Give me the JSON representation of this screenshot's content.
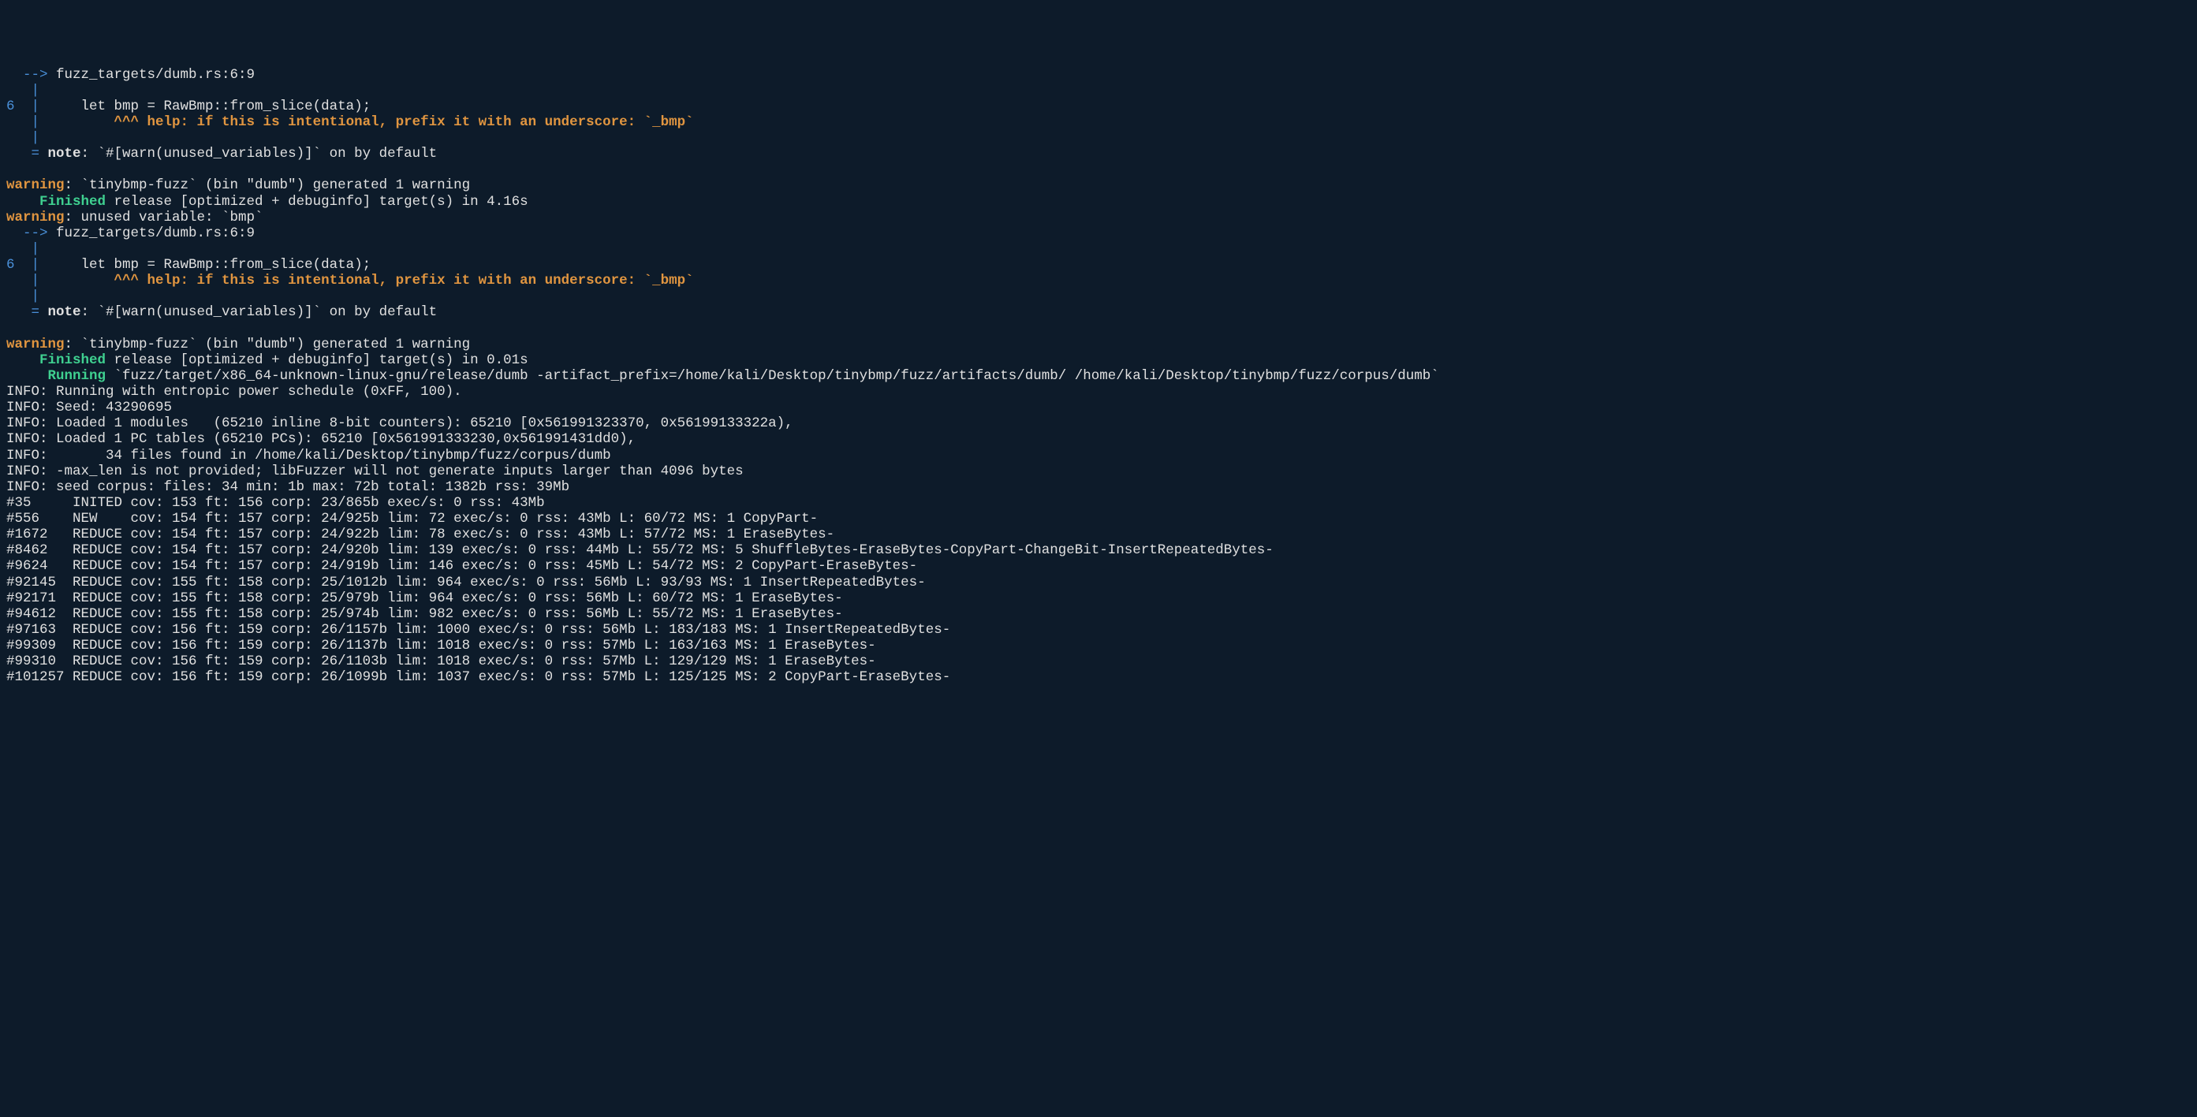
{
  "lines": [
    {
      "segs": [
        {
          "cls": "arrow",
          "t": "  -->"
        },
        {
          "cls": "normal",
          "t": " fuzz_targets/dumb.rs:6:9"
        }
      ]
    },
    {
      "segs": [
        {
          "cls": "pipe",
          "t": "   |"
        }
      ]
    },
    {
      "segs": [
        {
          "cls": "linenum",
          "t": "6  |"
        },
        {
          "cls": "normal",
          "t": "     let bmp = RawBmp::from_slice(data);"
        }
      ]
    },
    {
      "segs": [
        {
          "cls": "pipe",
          "t": "   |"
        },
        {
          "cls": "normal",
          "t": "         "
        },
        {
          "cls": "help",
          "t": "^^^ help: if this is intentional, prefix it with an underscore: `_bmp`"
        }
      ]
    },
    {
      "segs": [
        {
          "cls": "pipe",
          "t": "   |"
        }
      ]
    },
    {
      "segs": [
        {
          "cls": "note-eq",
          "t": "   = "
        },
        {
          "cls": "note-label",
          "t": "note"
        },
        {
          "cls": "normal",
          "t": ": `#[warn(unused_variables)]` on by default"
        }
      ]
    },
    {
      "segs": [
        {
          "cls": "normal",
          "t": " "
        }
      ]
    },
    {
      "segs": [
        {
          "cls": "warning",
          "t": "warning"
        },
        {
          "cls": "normal",
          "t": ": `tinybmp-fuzz` (bin \"dumb\") generated 1 warning"
        }
      ]
    },
    {
      "segs": [
        {
          "cls": "normal",
          "t": "    "
        },
        {
          "cls": "finished",
          "t": "Finished"
        },
        {
          "cls": "normal",
          "t": " release [optimized + debuginfo] target(s) in 4.16s"
        }
      ]
    },
    {
      "segs": [
        {
          "cls": "warning",
          "t": "warning"
        },
        {
          "cls": "normal",
          "t": ": unused variable: `bmp`"
        }
      ]
    },
    {
      "segs": [
        {
          "cls": "arrow",
          "t": "  -->"
        },
        {
          "cls": "normal",
          "t": " fuzz_targets/dumb.rs:6:9"
        }
      ]
    },
    {
      "segs": [
        {
          "cls": "pipe",
          "t": "   |"
        }
      ]
    },
    {
      "segs": [
        {
          "cls": "linenum",
          "t": "6  |"
        },
        {
          "cls": "normal",
          "t": "     let bmp = RawBmp::from_slice(data);"
        }
      ]
    },
    {
      "segs": [
        {
          "cls": "pipe",
          "t": "   |"
        },
        {
          "cls": "normal",
          "t": "         "
        },
        {
          "cls": "help",
          "t": "^^^ help: if this is intentional, prefix it with an underscore: `_bmp`"
        }
      ]
    },
    {
      "segs": [
        {
          "cls": "pipe",
          "t": "   |"
        }
      ]
    },
    {
      "segs": [
        {
          "cls": "note-eq",
          "t": "   = "
        },
        {
          "cls": "note-label",
          "t": "note"
        },
        {
          "cls": "normal",
          "t": ": `#[warn(unused_variables)]` on by default"
        }
      ]
    },
    {
      "segs": [
        {
          "cls": "normal",
          "t": " "
        }
      ]
    },
    {
      "segs": [
        {
          "cls": "warning",
          "t": "warning"
        },
        {
          "cls": "normal",
          "t": ": `tinybmp-fuzz` (bin \"dumb\") generated 1 warning"
        }
      ]
    },
    {
      "segs": [
        {
          "cls": "normal",
          "t": "    "
        },
        {
          "cls": "finished",
          "t": "Finished"
        },
        {
          "cls": "normal",
          "t": " release [optimized + debuginfo] target(s) in 0.01s"
        }
      ]
    },
    {
      "segs": [
        {
          "cls": "normal",
          "t": "     "
        },
        {
          "cls": "running",
          "t": "Running"
        },
        {
          "cls": "normal",
          "t": " `fuzz/target/x86_64-unknown-linux-gnu/release/dumb -artifact_prefix=/home/kali/Desktop/tinybmp/fuzz/artifacts/dumb/ /home/kali/Desktop/tinybmp/fuzz/corpus/dumb`"
        }
      ]
    },
    {
      "segs": [
        {
          "cls": "normal",
          "t": "INFO: Running with entropic power schedule (0xFF, 100)."
        }
      ]
    },
    {
      "segs": [
        {
          "cls": "normal",
          "t": "INFO: Seed: 43290695"
        }
      ]
    },
    {
      "segs": [
        {
          "cls": "normal",
          "t": "INFO: Loaded 1 modules   (65210 inline 8-bit counters): 65210 [0x561991323370, 0x56199133322a),"
        }
      ]
    },
    {
      "segs": [
        {
          "cls": "normal",
          "t": "INFO: Loaded 1 PC tables (65210 PCs): 65210 [0x561991333230,0x561991431dd0),"
        }
      ]
    },
    {
      "segs": [
        {
          "cls": "normal",
          "t": "INFO:       34 files found in /home/kali/Desktop/tinybmp/fuzz/corpus/dumb"
        }
      ]
    },
    {
      "segs": [
        {
          "cls": "normal",
          "t": "INFO: -max_len is not provided; libFuzzer will not generate inputs larger than 4096 bytes"
        }
      ]
    },
    {
      "segs": [
        {
          "cls": "normal",
          "t": "INFO: seed corpus: files: 34 min: 1b max: 72b total: 1382b rss: 39Mb"
        }
      ]
    },
    {
      "segs": [
        {
          "cls": "normal",
          "t": "#35     INITED cov: 153 ft: 156 corp: 23/865b exec/s: 0 rss: 43Mb"
        }
      ]
    },
    {
      "segs": [
        {
          "cls": "normal",
          "t": "#556    NEW    cov: 154 ft: 157 corp: 24/925b lim: 72 exec/s: 0 rss: 43Mb L: 60/72 MS: 1 CopyPart-"
        }
      ]
    },
    {
      "segs": [
        {
          "cls": "normal",
          "t": "#1672   REDUCE cov: 154 ft: 157 corp: 24/922b lim: 78 exec/s: 0 rss: 43Mb L: 57/72 MS: 1 EraseBytes-"
        }
      ]
    },
    {
      "segs": [
        {
          "cls": "normal",
          "t": "#8462   REDUCE cov: 154 ft: 157 corp: 24/920b lim: 139 exec/s: 0 rss: 44Mb L: 55/72 MS: 5 ShuffleBytes-EraseBytes-CopyPart-ChangeBit-InsertRepeatedBytes-"
        }
      ]
    },
    {
      "segs": [
        {
          "cls": "normal",
          "t": "#9624   REDUCE cov: 154 ft: 157 corp: 24/919b lim: 146 exec/s: 0 rss: 45Mb L: 54/72 MS: 2 CopyPart-EraseBytes-"
        }
      ]
    },
    {
      "segs": [
        {
          "cls": "normal",
          "t": "#92145  REDUCE cov: 155 ft: 158 corp: 25/1012b lim: 964 exec/s: 0 rss: 56Mb L: 93/93 MS: 1 InsertRepeatedBytes-"
        }
      ]
    },
    {
      "segs": [
        {
          "cls": "normal",
          "t": "#92171  REDUCE cov: 155 ft: 158 corp: 25/979b lim: 964 exec/s: 0 rss: 56Mb L: 60/72 MS: 1 EraseBytes-"
        }
      ]
    },
    {
      "segs": [
        {
          "cls": "normal",
          "t": "#94612  REDUCE cov: 155 ft: 158 corp: 25/974b lim: 982 exec/s: 0 rss: 56Mb L: 55/72 MS: 1 EraseBytes-"
        }
      ]
    },
    {
      "segs": [
        {
          "cls": "normal",
          "t": "#97163  REDUCE cov: 156 ft: 159 corp: 26/1157b lim: 1000 exec/s: 0 rss: 56Mb L: 183/183 MS: 1 InsertRepeatedBytes-"
        }
      ]
    },
    {
      "segs": [
        {
          "cls": "normal",
          "t": "#99309  REDUCE cov: 156 ft: 159 corp: 26/1137b lim: 1018 exec/s: 0 rss: 57Mb L: 163/163 MS: 1 EraseBytes-"
        }
      ]
    },
    {
      "segs": [
        {
          "cls": "normal",
          "t": "#99310  REDUCE cov: 156 ft: 159 corp: 26/1103b lim: 1018 exec/s: 0 rss: 57Mb L: 129/129 MS: 1 EraseBytes-"
        }
      ]
    },
    {
      "segs": [
        {
          "cls": "normal",
          "t": "#101257 REDUCE cov: 156 ft: 159 corp: 26/1099b lim: 1037 exec/s: 0 rss: 57Mb L: 125/125 MS: 2 CopyPart-EraseBytes-"
        }
      ]
    }
  ]
}
